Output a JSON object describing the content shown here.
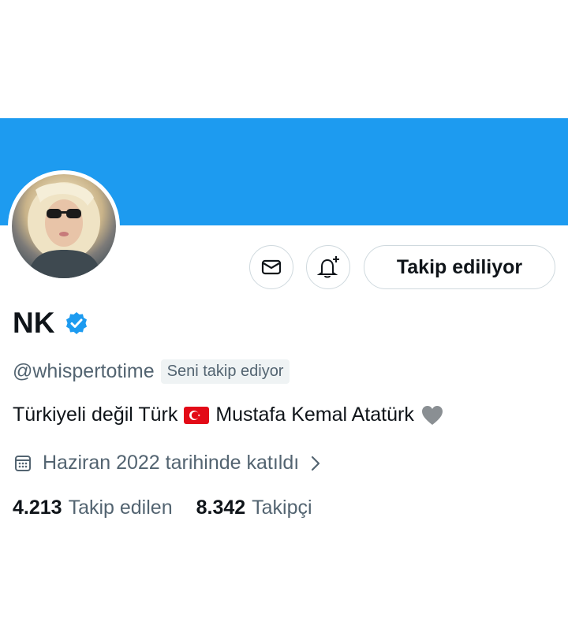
{
  "profile": {
    "name": "NK",
    "handle": "@whispertotime",
    "follows_you_badge": "Seni takip ediyor",
    "bio": {
      "part1": "Türkiyeli değil Türk",
      "part2": "Mustafa Kemal Atatürk"
    },
    "joined": "Haziran 2022 tarihinde katıldı",
    "following_count": "4.213",
    "following_label": "Takip edilen",
    "followers_count": "8.342",
    "followers_label": "Takipçi"
  },
  "actions": {
    "follow_state_label": "Takip ediliyor"
  },
  "icons": {
    "message": "envelope-icon",
    "notify": "bell-plus-icon",
    "verified": "verified-badge-icon",
    "calendar": "calendar-icon",
    "chevron": "chevron-right-icon",
    "flag": "turkey-flag-icon",
    "heart": "grey-heart-icon"
  },
  "colors": {
    "banner": "#1d9bf0",
    "primary_text": "#0f1419",
    "secondary_text": "#536471",
    "border": "#cfd9de",
    "verified_blue": "#1d9bf0"
  }
}
